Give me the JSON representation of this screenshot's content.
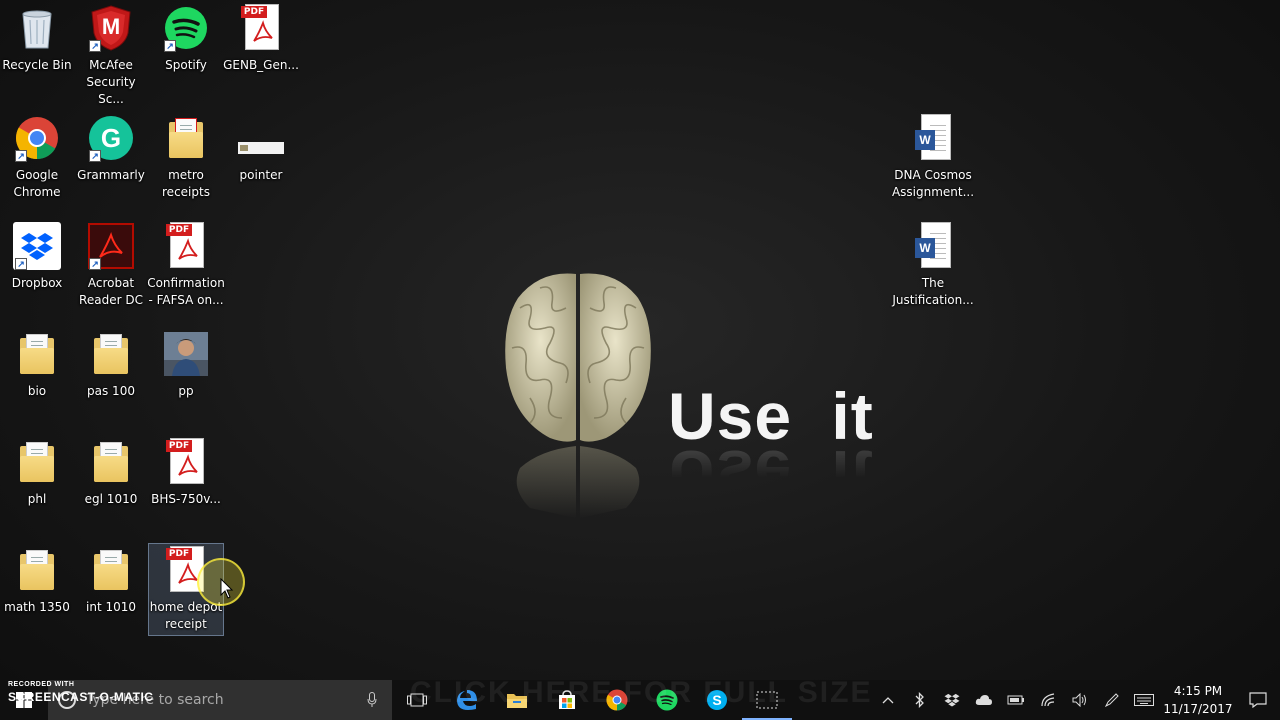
{
  "desktop": {
    "icons": {
      "recycle_bin": "Recycle Bin",
      "mcafee": "McAfee Security Sc...",
      "spotify": "Spotify",
      "genb": "GENB_Gen...",
      "chrome": "Google Chrome",
      "grammarly": "Grammarly",
      "metro": "metro receipts",
      "pointer": "pointer",
      "dropbox": "Dropbox",
      "acrobat": "Acrobat Reader DC",
      "fafsa": "Confirmation - FAFSA on...",
      "bio": "bio",
      "pas100": "pas 100",
      "pp": "pp",
      "phl": "phl",
      "egl1010": "egl 1010",
      "bhs": "BHS-750v...",
      "math1350": "math 1350",
      "int1010": "int 1010",
      "homedepot": "home depot receipt",
      "dna": "DNA Cosmos Assignment...",
      "justification": "The Justification..."
    },
    "pdf_tag": "PDF",
    "word_badge": "W",
    "mcafee_letter": "M",
    "grammarly_letter": "G"
  },
  "wallpaper": {
    "slogan": "Use  it"
  },
  "watermark": "CLICK HERE FOR FULL SIZE",
  "screencast": {
    "recorded_with": "RECORDED WITH",
    "brand": "SCREENCAST-O-MATIC"
  },
  "taskbar": {
    "search_placeholder": "Type here to search",
    "apps": [
      "task-view",
      "edge",
      "file-explorer",
      "store",
      "chrome",
      "spotify",
      "skype",
      "snipping-tool"
    ],
    "active_app": "snipping-tool",
    "tray": [
      "chevron-up",
      "bluetooth",
      "dropbox",
      "onedrive",
      "battery",
      "wifi",
      "volume",
      "pen",
      "keyboard"
    ],
    "time": "4:15 PM",
    "date": "11/17/2017"
  },
  "colors": {
    "taskbar": "#101010",
    "search": "#303030",
    "pdf_red": "#d31d1d",
    "word_blue": "#2b579a"
  }
}
